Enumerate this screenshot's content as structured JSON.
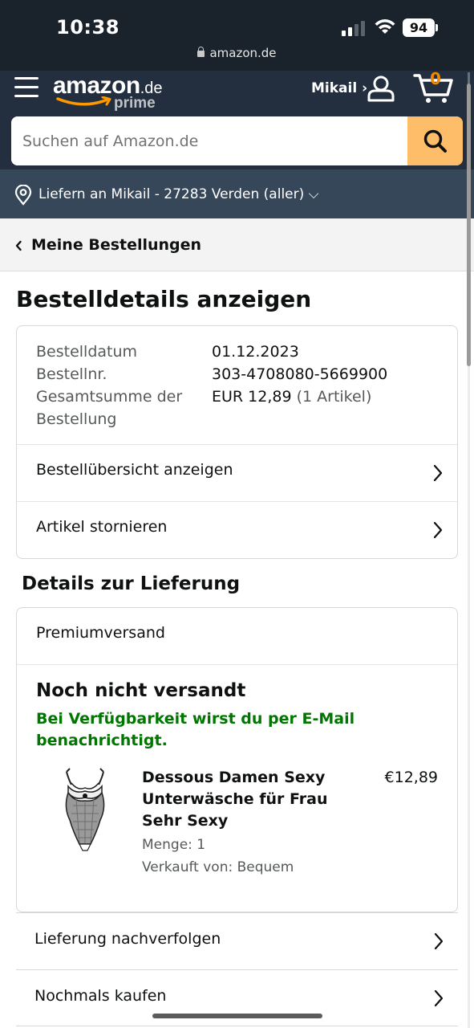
{
  "status_bar": {
    "time": "10:38",
    "battery": "94",
    "url": "amazon.de"
  },
  "header": {
    "logo_main": "amazon",
    "logo_suffix": ".de",
    "logo_prime": "prime",
    "account_label": "Mikail ›",
    "cart_count": "0",
    "search_placeholder": "Suchen auf Amazon.de",
    "deliver_to": "Liefern an Mikail - 27283 Verden (aller) ⌵"
  },
  "breadcrumb": {
    "label": "Meine Bestellungen"
  },
  "page": {
    "title": "Bestelldetails anzeigen"
  },
  "order": {
    "date_label": "Bestelldatum",
    "date_value": "01.12.2023",
    "number_label": "Bestellnr.",
    "number_value": "303-4708080-5669900",
    "total_label_1": "Gesamtsumme der",
    "total_label_2": "Bestellung",
    "total_value": "EUR 12,89",
    "total_items": "(1 Artikel)",
    "actions": [
      {
        "label": "Bestellübersicht anzeigen"
      },
      {
        "label": "Artikel stornieren"
      }
    ]
  },
  "delivery": {
    "section_title": "Details zur Lieferung",
    "method": "Premiumversand",
    "status": "Noch nicht versandt",
    "notice": "Bei Verfügbarkeit wirst du per E-Mail benachrichtigt.",
    "product": {
      "title": "Dessous Damen Sexy Unterwäsche für Frau Sehr Sexy",
      "price": "€12,89",
      "quantity": "Menge: 1",
      "seller": "Verkauft von: Bequem"
    }
  },
  "more_actions": [
    {
      "label": "Lieferung nachverfolgen"
    },
    {
      "label": "Nochmals kaufen"
    }
  ],
  "colors": {
    "header_bg": "#232f3e",
    "deliver_bg": "#37475a",
    "search_button": "#febd69",
    "cart_count": "#f08804",
    "notice_green": "#007600"
  },
  "icons": [
    "menu-icon",
    "user-icon",
    "cart-icon",
    "search-icon",
    "location-pin-icon",
    "chevron-left-icon",
    "chevron-right-icon",
    "lock-icon",
    "wifi-icon",
    "signal-icon"
  ]
}
